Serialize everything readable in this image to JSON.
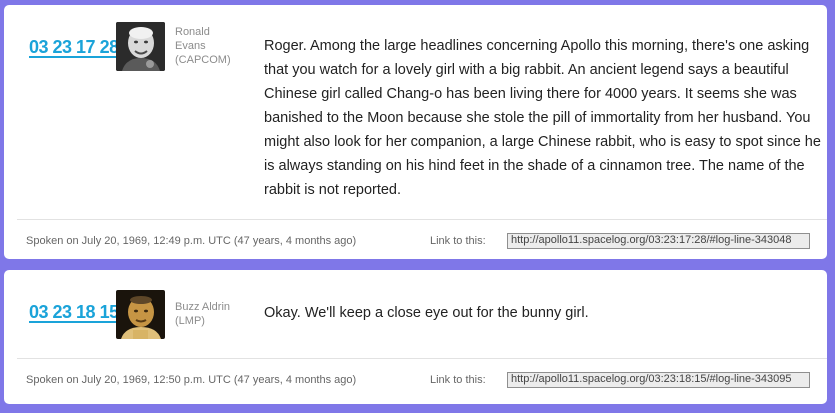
{
  "entries": [
    {
      "timestamp": "03 23 17 28",
      "speaker": {
        "first_name": "Ronald",
        "last_name": "Evans",
        "role": "(CAPCOM)"
      },
      "message": "Roger. Among the large headlines concerning Apollo this morning, there's one asking that you watch for a lovely girl with a big rabbit. An ancient legend says a beautiful Chinese girl called Chang-o has been living there for 4000 years. It seems she was banished to the Moon because she stole the pill of immortality from her husband. You might also look for her companion, a large Chinese rabbit, who is easy to spot since he is always standing on his hind feet in the shade of a cinnamon tree. The name of the rabbit is not reported.",
      "spoken_on": "Spoken on July 20, 1969, 12:49 p.m. UTC (47 years, 4 months ago)",
      "link_label": "Link to this:",
      "link_url": "http://apollo11.spacelog.org/03:23:17:28/#log-line-343048"
    },
    {
      "timestamp": "03 23 18 15",
      "speaker": {
        "first_name": "Buzz Aldrin",
        "last_name": "",
        "role": "(LMP)"
      },
      "message": "Okay. We'll keep a close eye out for the bunny girl.",
      "spoken_on": "Spoken on July 20, 1969, 12:50 p.m. UTC (47 years, 4 months ago)",
      "link_label": "Link to this:",
      "link_url": "http://apollo11.spacelog.org/03:23:18:15/#log-line-343095"
    }
  ],
  "colors": {
    "page_background": "#7f77e8",
    "card_background": "#ffffff",
    "timestamp_link": "#1aa3d9",
    "speaker_text": "#8c8c8c",
    "message_text": "#222222"
  },
  "icons": {
    "avatar_1": "ronald-evans-photo",
    "avatar_2": "buzz-aldrin-photo"
  }
}
